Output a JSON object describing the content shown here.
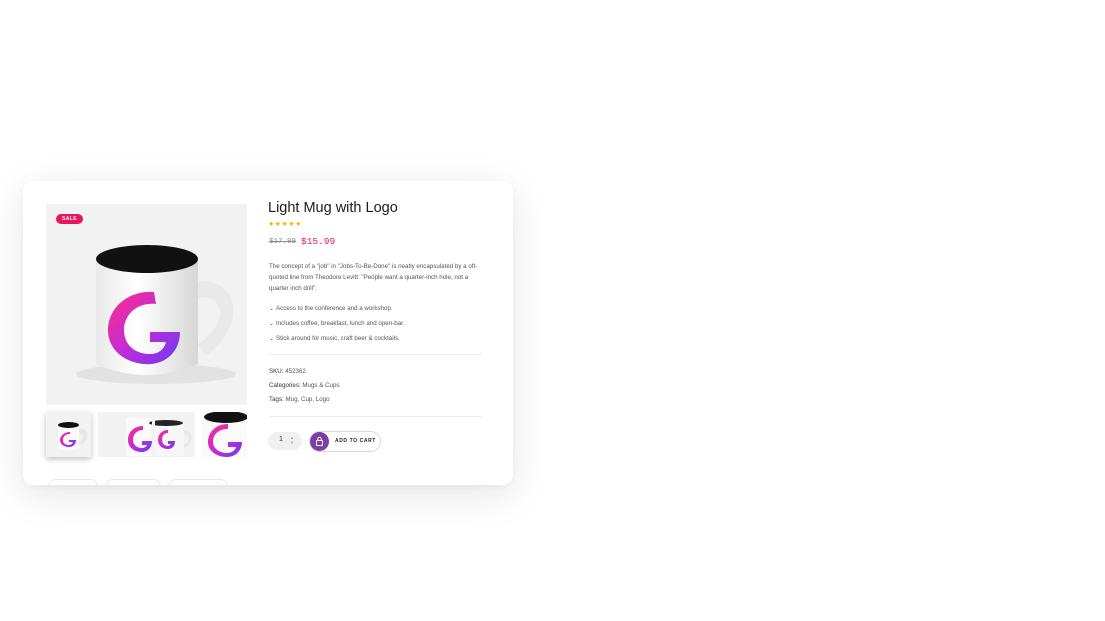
{
  "product": {
    "badge": "SALE",
    "title": "Light Mug with Logo",
    "rating": "★★★★★",
    "old_price": "$17.99",
    "new_price": "$15.99",
    "description": "The concept of a \"job\" in \"Jobs-To-Be-Done\" is neatly encapsulated by a oft-quoted line from Theodore Levitt: \"People want a quarter-inch hole, not a quarter inch drill\".",
    "features": [
      "Access to the conference and a workshop.",
      "Includes coffee, breakfast, lunch and open-bar.",
      "Stick around for music, craft beer & cocktails."
    ],
    "sku_label": "SKU:",
    "sku_value": "452362",
    "categories_label": "Categories:",
    "categories_value": "Mugs & Cups",
    "tags_label": "Tags:",
    "tags_value": "Mug, Cup, Logo",
    "quantity": "1",
    "add_to_cart": "ADD TO CART"
  },
  "colors": {
    "accent": "#e8175d",
    "button": "#7b3fa6",
    "stars": "#f7b500"
  }
}
